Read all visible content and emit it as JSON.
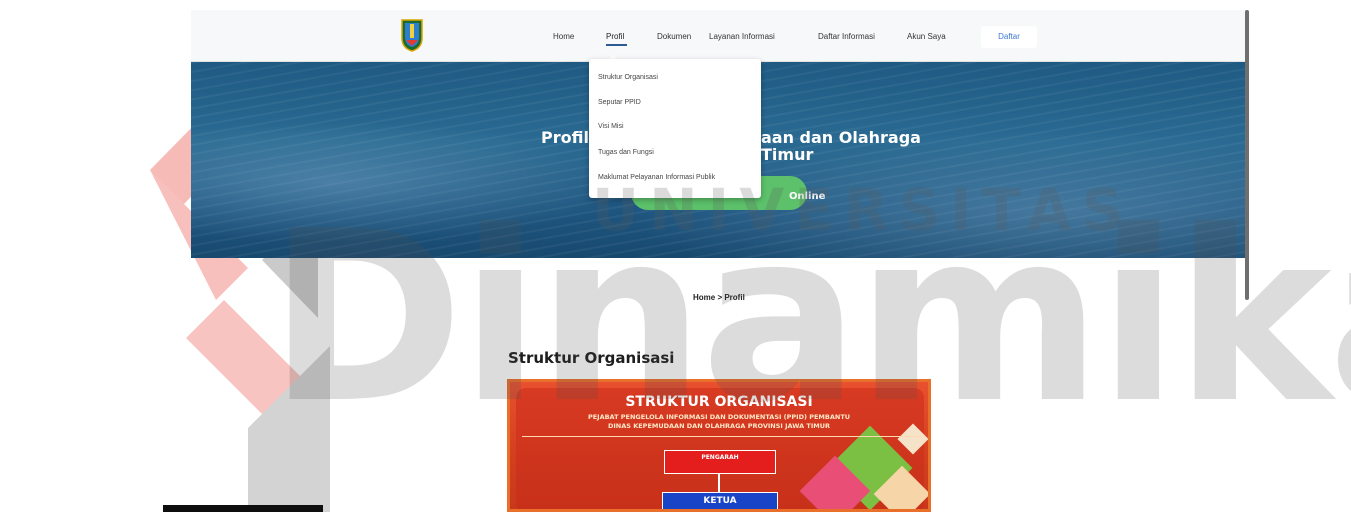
{
  "nav": {
    "items": [
      {
        "label": "Home",
        "active": false
      },
      {
        "label": "Profil",
        "active": true
      },
      {
        "label": "Dokumen",
        "active": false
      },
      {
        "label": "Layanan Informasi",
        "active": false
      },
      {
        "label": "Daftar Informasi",
        "active": false
      },
      {
        "label": "Akun Saya",
        "active": false
      }
    ],
    "register_button": "Daftar",
    "accent_color": "#2e5a92"
  },
  "dropdown": {
    "items": [
      "Struktur Organisasi",
      "Seputar PPID",
      "Visi Misi",
      "Tugas dan Fungsi",
      "Maklumat Pelayanan Informasi Publik"
    ]
  },
  "hero": {
    "title_left": "Profil",
    "title_right": "aan dan Olahraga",
    "title_line2": "Timur",
    "button_label": "Online",
    "button_color": "#5cc16a"
  },
  "breadcrumb": "Home > Profil",
  "section_title": "Struktur Organisasi",
  "org_chart": {
    "title": "STRUKTUR ORGANISASI",
    "subtitle_line1": "PEJABAT PENGELOLA INFORMASI DAN DOKUMENTASI (PPID) PEMBANTU",
    "subtitle_line2": "DINAS KEPEMUDAAN DAN OLAHRAGA PROVINSI JAWA TIMUR",
    "pengarah": "PENGARAH",
    "ketua": "KETUA"
  },
  "watermark": {
    "top": "UNIVERSITAS",
    "main": "Dinamika"
  }
}
